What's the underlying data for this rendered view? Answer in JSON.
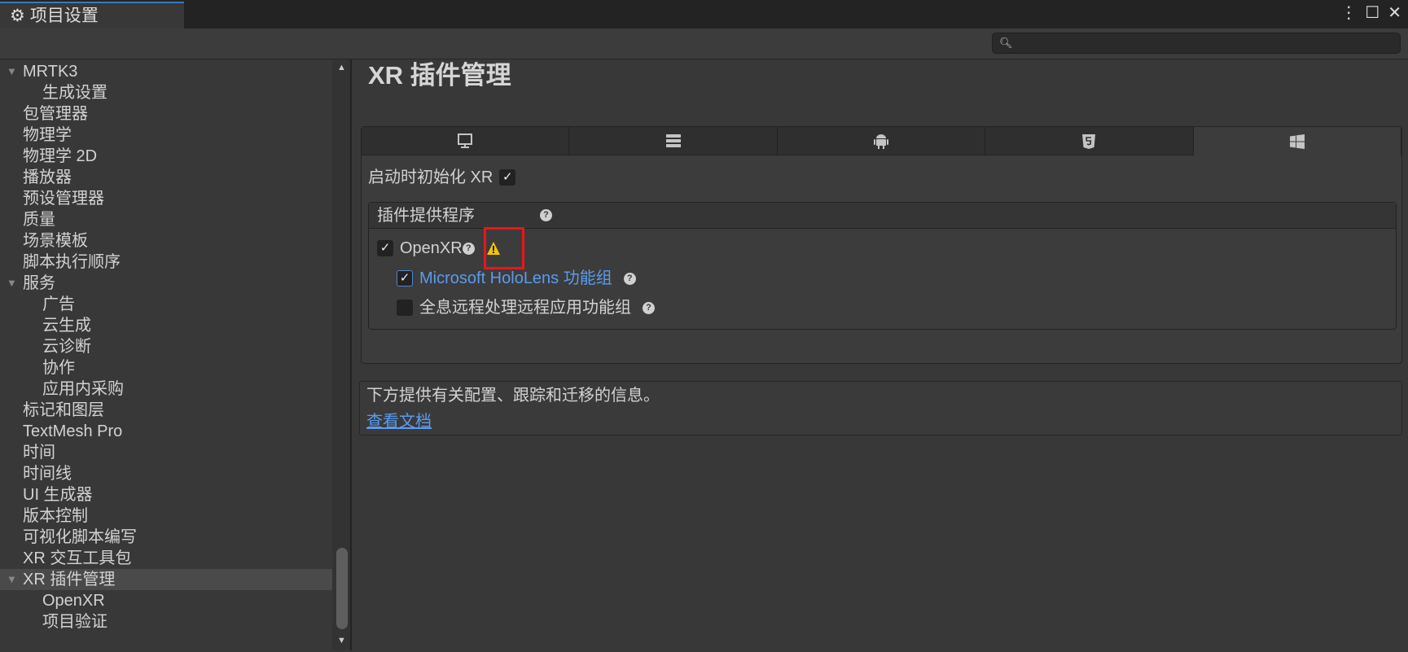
{
  "window": {
    "tab_title": "项目设置",
    "icon": "gear-icon",
    "controls": [
      "more-icon",
      "maximize-icon",
      "close-icon"
    ]
  },
  "search": {
    "placeholder": "",
    "value": ""
  },
  "sidebar": {
    "items": [
      {
        "label": "MRTK3",
        "level": 0,
        "expanded": true
      },
      {
        "label": "生成设置",
        "level": 1
      },
      {
        "label": "包管理器",
        "level": 0
      },
      {
        "label": "物理学",
        "level": 0
      },
      {
        "label": "物理学 2D",
        "level": 0
      },
      {
        "label": "播放器",
        "level": 0
      },
      {
        "label": "预设管理器",
        "level": 0
      },
      {
        "label": "质量",
        "level": 0
      },
      {
        "label": "场景模板",
        "level": 0
      },
      {
        "label": "脚本执行顺序",
        "level": 0
      },
      {
        "label": "服务",
        "level": 0,
        "expanded": true
      },
      {
        "label": "广告",
        "level": 1
      },
      {
        "label": "云生成",
        "level": 1
      },
      {
        "label": "云诊断",
        "level": 1
      },
      {
        "label": "协作",
        "level": 1
      },
      {
        "label": "应用内采购",
        "level": 1
      },
      {
        "label": "标记和图层",
        "level": 0
      },
      {
        "label": "TextMesh Pro",
        "level": 0
      },
      {
        "label": "时间",
        "level": 0
      },
      {
        "label": "时间线",
        "level": 0
      },
      {
        "label": "UI 生成器",
        "level": 0
      },
      {
        "label": "版本控制",
        "level": 0
      },
      {
        "label": "可视化脚本编写",
        "level": 0
      },
      {
        "label": "XR 交互工具包",
        "level": 0
      },
      {
        "label": "XR 插件管理",
        "level": 0,
        "expanded": true,
        "selected": true
      },
      {
        "label": "OpenXR",
        "level": 1
      },
      {
        "label": "项目验证",
        "level": 1
      }
    ]
  },
  "main": {
    "title": "XR 插件管理",
    "platform_tabs": [
      {
        "icon": "monitor-icon",
        "active": false
      },
      {
        "icon": "server-icon",
        "active": false
      },
      {
        "icon": "android-icon",
        "active": false
      },
      {
        "icon": "html5-icon",
        "active": false
      },
      {
        "icon": "windows-icon",
        "active": true
      }
    ],
    "init_on_startup": {
      "label": "启动时初始化 XR",
      "checked": true
    },
    "providers": {
      "header": "插件提供程序",
      "openxr": {
        "label": "OpenXR",
        "checked": true
      },
      "groups": [
        {
          "label": "Microsoft HoloLens 功能组",
          "checked": true
        },
        {
          "label": "全息远程处理远程应用功能组",
          "checked": false
        }
      ]
    },
    "info": {
      "text": "下方提供有关配置、跟踪和迁移的信息。",
      "link": "查看文档"
    }
  },
  "colors": {
    "link": "#5b9bec",
    "warning": "#f4c400",
    "highlight_box": "#e8161c",
    "tab_accent": "#3a79bb"
  }
}
